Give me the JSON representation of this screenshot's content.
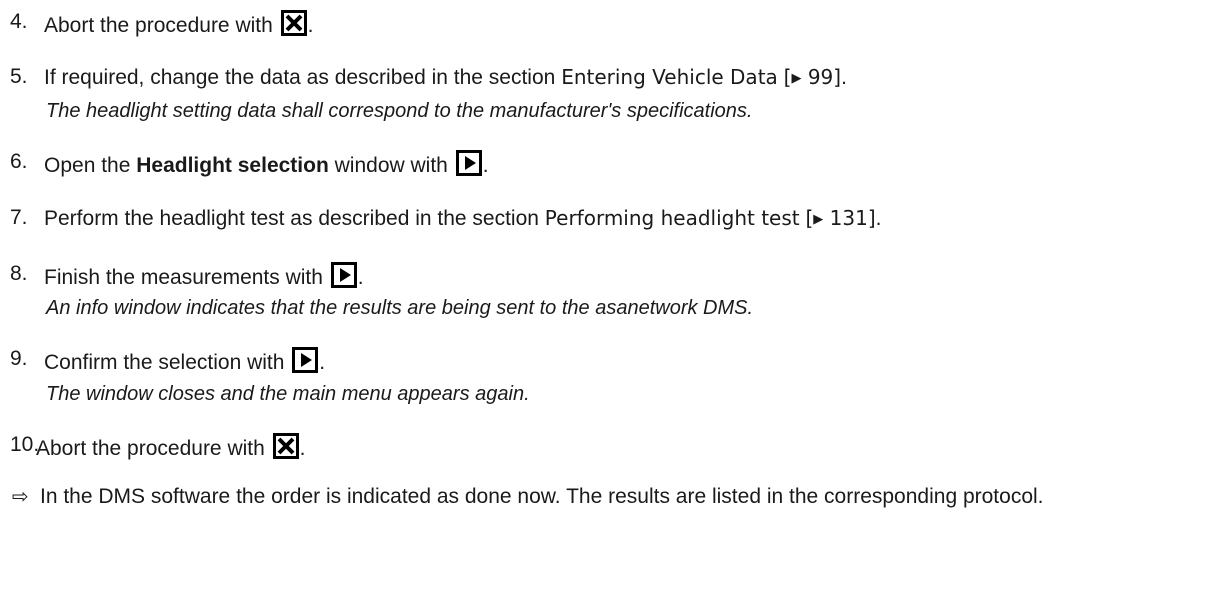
{
  "steps": [
    {
      "number": "4.",
      "text_before": "Abort the procedure with",
      "icon": "abort-x-box-icon",
      "text_after": "."
    },
    {
      "number": "5.",
      "text_before": "If required, change the data as described in the section",
      "ref_title": "Entering Vehicle Data",
      "ref_open": "[",
      "ref_arrow": "▶",
      "ref_page": "99]",
      "text_after": ".",
      "note": "The headlight setting data shall correspond to the manufacturer's specifications."
    },
    {
      "number": "6.",
      "text_before": "Open the",
      "bold": "Headlight selection",
      "text_middle": "window with",
      "icon": "play-box-icon",
      "text_after": "."
    },
    {
      "number": "7.",
      "text_before": "Perform the headlight test as described in the section",
      "ref_title": "Performing headlight test",
      "ref_open": "[",
      "ref_arrow": "▶",
      "ref_page": "131]",
      "text_after": "."
    },
    {
      "number": "8.",
      "text_before": "Finish the measurements with",
      "icon": "play-box-icon",
      "text_after": ".",
      "note": "An info window indicates that the results are being sent to the asanetwork DMS."
    },
    {
      "number": "9.",
      "text_before": "Confirm the selection with",
      "icon": "play-box-icon",
      "text_after": ".",
      "note": "The window closes and the main menu appears again."
    },
    {
      "number": "10.",
      "text_before": "Abort the procedure with",
      "icon": "abort-x-box-icon",
      "text_after": "."
    }
  ],
  "result": {
    "arrow": "⇨",
    "text": "In the DMS software the order is indicated as done now. The results are listed in the corresponding protocol."
  }
}
